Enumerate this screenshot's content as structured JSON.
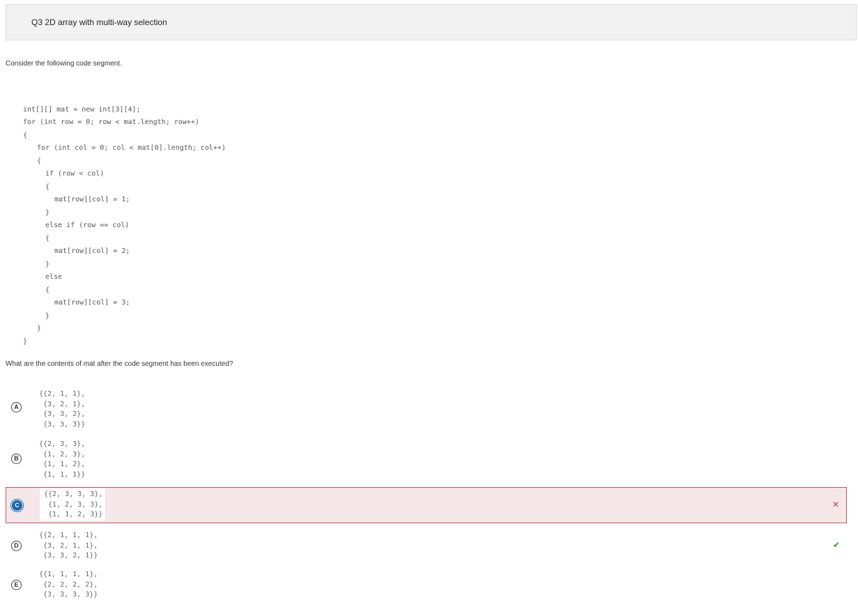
{
  "header": {
    "title": "Q3 2D array with multi-way selection"
  },
  "prompt": "Consider the following code segment.",
  "code": {
    "lines": [
      "int[][] mat = new int[3][4];",
      "for (int row = 0; row < mat.length; row++)",
      "{",
      "  for (int col = 0; col < mat[0].length; col++)",
      "  {",
      "    if (row < col)",
      "    {",
      "      mat[row][col] = 1;",
      "    }",
      "    else if (row == col)",
      "    {",
      "      mat[row][col] = 2;",
      "    }",
      "    else",
      "    {",
      "      mat[row][col] = 3;",
      "    }",
      "  }",
      "}"
    ]
  },
  "question": "What are the contents of mat after the code segment has been executed?",
  "choices": [
    {
      "letter": "A",
      "text": "{{2, 1, 1},\n {3, 2, 1},\n {3, 3, 2},\n {3, 3, 3}}"
    },
    {
      "letter": "B",
      "text": "{{2, 3, 3},\n {1, 2, 3},\n {1, 1, 2},\n {1, 1, 1}}"
    },
    {
      "letter": "C",
      "text": "{{2, 3, 3, 3},\n {1, 2, 3, 3},\n {1, 1, 2, 3}}",
      "selected": true,
      "result_icon": "cross-icon",
      "result_glyph": "✕"
    },
    {
      "letter": "D",
      "text": "{{2, 1, 1, 1},\n {3, 2, 1, 1},\n {3, 3, 2, 1}}",
      "correct": true,
      "result_icon": "check-icon",
      "result_glyph": "✔"
    },
    {
      "letter": "E",
      "text": "{{1, 1, 1, 1},\n {2, 2, 2, 2},\n {3, 3, 3, 3}}"
    }
  ],
  "colors": {
    "selected_bg": "#f5e6e8",
    "selected_border": "#c45560",
    "radio_fill": "#1565a8",
    "wrong": "#c44a55",
    "right": "#2e8b3e"
  }
}
